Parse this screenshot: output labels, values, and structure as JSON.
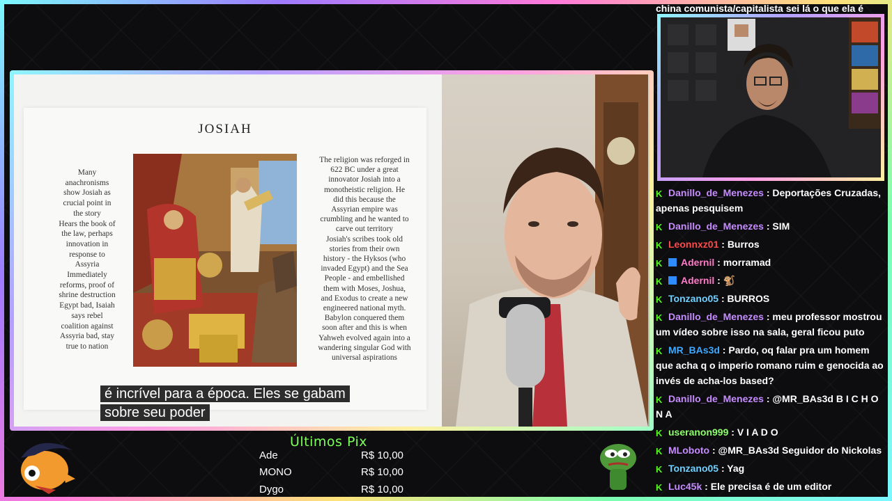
{
  "slide": {
    "title": "JOSIAH",
    "left_text": "Many\nanachronisms\nshow Josiah as\ncrucial point in\nthe story\nHears the book of\nthe law, perhaps\ninnovation in\nresponse to\nAssyria\nImmediately\nreforms, proof of\nshrine destruction\nEgypt bad, Isaiah\nsays rebel\ncoalition against\nAssyria bad, stay\ntrue to nation",
    "right_text": "The religion was reforged in\n622 BC under a great\ninnovator Josiah into a\nmonotheistic religion. He\ndid this because the\nAssyrian empire was\ncrumbling and he wanted to\ncarve out territory\nJosiah's scribes took old\nstories from their own\nhistory - the Hyksos (who\ninvaded Egypt) and the Sea\nPeople - and embellished\nthem with Moses, Joshua,\nand Exodus to create a new\nengineered national myth.\nBabylon conquered them\nsoon after and this is when\nYahweh evolved again into a\nwandering singular God with\nuniversal aspirations"
  },
  "subtitle": {
    "line1": "é incrível para a época. Eles se gabam",
    "line2": "sobre seu poder"
  },
  "chat_top": "china comunista/capitalista sei lá o que ela é",
  "chat": [
    {
      "user": "Danillo_de_Menezes",
      "color": "#c58bff",
      "text": "Deportações Cruzadas, apenas pesquisem",
      "badge2": false
    },
    {
      "user": "Danillo_de_Menezes",
      "color": "#c58bff",
      "text": "SIM",
      "badge2": false
    },
    {
      "user": "Leonnxz01",
      "color": "#ff4a4a",
      "text": "Burros",
      "badge2": false
    },
    {
      "user": "Adernil",
      "color": "#ff7ac8",
      "text": "morramad",
      "badge2": true
    },
    {
      "user": "Adernil",
      "color": "#ff7ac8",
      "text": "🐒",
      "badge2": true
    },
    {
      "user": "Tonzano05",
      "color": "#6fd0ff",
      "text": "BURROS",
      "badge2": false
    },
    {
      "user": "Danillo_de_Menezes",
      "color": "#c58bff",
      "text": "meu professor mostrou um vídeo sobre isso na sala, geral ficou puto",
      "badge2": false
    },
    {
      "user": "MR_BAs3d",
      "color": "#3fa9ff",
      "text": "Pardo, oq falar pra um homem que acha q o imperio romano ruim e genocida ao invés de acha-los based?",
      "badge2": false
    },
    {
      "user": "Danillo_de_Menezes",
      "color": "#c58bff",
      "text": "@MR_BAs3d B I C H O N A",
      "badge2": false
    },
    {
      "user": "useranon999",
      "color": "#8dff6b",
      "text": "V I A D O",
      "badge2": false
    },
    {
      "user": "MLoboto",
      "color": "#c58bff",
      "text": "@MR_BAs3d Seguidor do Nickolas",
      "badge2": false
    },
    {
      "user": "Tonzano05",
      "color": "#6fd0ff",
      "text": "Yag",
      "badge2": false
    },
    {
      "user": "Luc45k",
      "color": "#c58bff",
      "text": "Ele precisa é de um editor",
      "badge2": false
    }
  ],
  "chat_badge_label": "K",
  "pix": {
    "title": "Últimos Pix",
    "rows": [
      {
        "name": "Ade",
        "amount": "R$ 10,00"
      },
      {
        "name": "MONO",
        "amount": "R$ 10,00"
      },
      {
        "name": "Dygo",
        "amount": "R$ 10,00"
      }
    ]
  }
}
